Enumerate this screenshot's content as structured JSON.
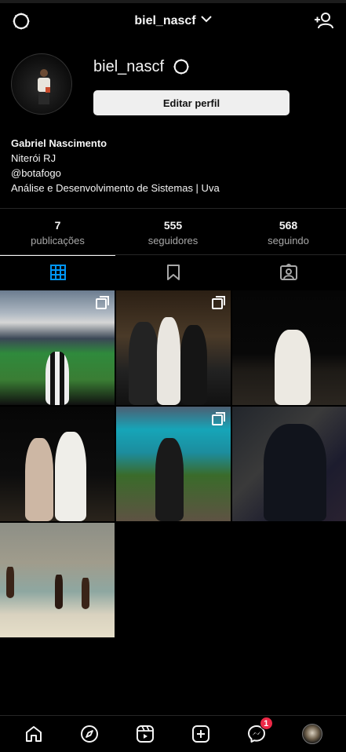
{
  "header": {
    "username": "biel_nascf",
    "icons": [
      "settings-icon",
      "chevron-down-icon",
      "add-user-icon"
    ]
  },
  "profile": {
    "username": "biel_nascf",
    "edit_button_label": "Editar perfil",
    "name": "Gabriel Nascimento",
    "bio_lines": [
      "Niterói RJ",
      "@botafogo",
      "Análise e Desenvolvimento de Sistemas | Uva"
    ]
  },
  "stats": [
    {
      "count": "7",
      "label": "publicações"
    },
    {
      "count": "555",
      "label": "seguidores"
    },
    {
      "count": "568",
      "label": "seguindo"
    }
  ],
  "tabs": [
    "grid-icon",
    "saved-icon",
    "tagged-icon"
  ],
  "posts": [
    {
      "subject": "stadium-photo",
      "multiple": true
    },
    {
      "subject": "friends-photo",
      "multiple": true
    },
    {
      "subject": "night-photo",
      "multiple": false
    },
    {
      "subject": "couple-photo",
      "multiple": false
    },
    {
      "subject": "beach-trail-photo",
      "multiple": true
    },
    {
      "subject": "city-view-photo",
      "multiple": false
    },
    {
      "subject": "beach-photo",
      "multiple": false
    }
  ],
  "bottom_nav": {
    "items": [
      "home-icon",
      "explore-icon",
      "reels-icon",
      "create-icon",
      "messenger-icon",
      "profile-avatar"
    ],
    "messenger_badge": "1"
  },
  "colors": {
    "background": "#000000",
    "text": "#f5f5f5",
    "secondary_text": "#a8a8a8",
    "badge": "#ed2846",
    "active_tab": "#0095f6"
  }
}
